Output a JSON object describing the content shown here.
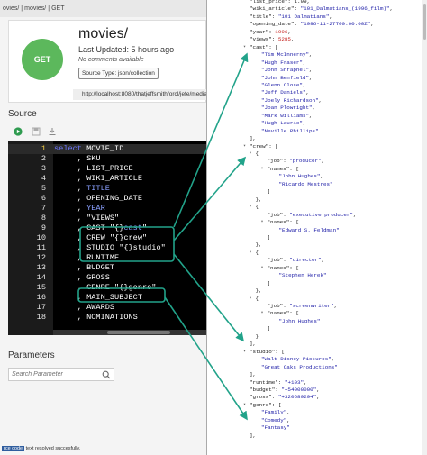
{
  "breadcrumb": {
    "items": [
      "ovies/",
      "|",
      "movies/",
      "|",
      "GET"
    ]
  },
  "card": {
    "method": "GET",
    "title": "movies/",
    "updated": "Last Updated: 5 hours ago",
    "comments": "No comments available",
    "source_type": "Source Type: json/collection",
    "url": "http://localhost:8080/thatjeffsmith/orcl/jefe/media/"
  },
  "source": {
    "label": "Source",
    "lines": [
      {
        "n": "1",
        "parts": [
          {
            "t": "select",
            "c": "kw"
          },
          {
            "t": " MOVIE_ID",
            "c": ""
          }
        ]
      },
      {
        "n": "2",
        "parts": [
          {
            "t": "     , SKU",
            "c": ""
          }
        ]
      },
      {
        "n": "3",
        "parts": [
          {
            "t": "     , LIST_PRICE",
            "c": ""
          }
        ]
      },
      {
        "n": "4",
        "parts": [
          {
            "t": "     , WIKI_ARTICLE",
            "c": ""
          }
        ]
      },
      {
        "n": "5",
        "parts": [
          {
            "t": "     , ",
            "c": ""
          },
          {
            "t": "TITLE",
            "c": "col-hl"
          }
        ]
      },
      {
        "n": "6",
        "parts": [
          {
            "t": "     , OPENING_DATE",
            "c": ""
          }
        ]
      },
      {
        "n": "7",
        "parts": [
          {
            "t": "     , ",
            "c": ""
          },
          {
            "t": "YEAR",
            "c": "col-hl"
          }
        ]
      },
      {
        "n": "8",
        "parts": [
          {
            "t": "     , \"VIEWS\"",
            "c": ""
          }
        ]
      },
      {
        "n": "9",
        "parts": [
          {
            "t": "     , CAST \"{}",
            "c": ""
          },
          {
            "t": "cast",
            "c": "col-hl"
          },
          {
            "t": "\"",
            "c": ""
          }
        ]
      },
      {
        "n": "10",
        "parts": [
          {
            "t": "     , CREW \"{}crew\"",
            "c": ""
          }
        ]
      },
      {
        "n": "11",
        "parts": [
          {
            "t": "     , STUDIO \"{}studio\"",
            "c": ""
          }
        ]
      },
      {
        "n": "12",
        "parts": [
          {
            "t": "     , RUNTIME",
            "c": ""
          }
        ]
      },
      {
        "n": "13",
        "parts": [
          {
            "t": "     , BUDGET",
            "c": ""
          }
        ]
      },
      {
        "n": "14",
        "parts": [
          {
            "t": "     , GROSS",
            "c": ""
          }
        ]
      },
      {
        "n": "15",
        "parts": [
          {
            "t": "     , GENRE \"{}genre\"",
            "c": ""
          }
        ]
      },
      {
        "n": "16",
        "parts": [
          {
            "t": "     , MAIN_SUBJECT",
            "c": ""
          }
        ]
      },
      {
        "n": "17",
        "parts": [
          {
            "t": "     , AWARDS",
            "c": ""
          }
        ]
      },
      {
        "n": "18",
        "parts": [
          {
            "t": "     , NOMINATIONS",
            "c": ""
          }
        ]
      }
    ],
    "active_line": "1"
  },
  "parameters": {
    "label": "Parameters",
    "search_placeholder": "Search Parameter"
  },
  "status": {
    "selected": "rce code",
    "message": " text resolved succesfully."
  },
  "json_view": {
    "lines": [
      {
        "i": 2,
        "raw": "\"list_price\": 1.99,"
      },
      {
        "i": 2,
        "k": "\"wiki_article\"",
        "v": "\"101_Dalmatians_(1996_film)\"",
        "vt": "s",
        "end": ","
      },
      {
        "i": 2,
        "k": "\"title\"",
        "v": "\"101 Dalmatians\"",
        "vt": "s",
        "end": ","
      },
      {
        "i": 2,
        "k": "\"opening_date\"",
        "v": "\"1996-11-27T00:00:00Z\"",
        "vt": "s",
        "end": ","
      },
      {
        "i": 2,
        "k": "\"year\"",
        "v": "1996",
        "vt": "n",
        "end": ","
      },
      {
        "i": 2,
        "k": "\"views\"",
        "v": "5285",
        "vt": "n",
        "end": ","
      },
      {
        "i": 2,
        "k": "\"cast\"",
        "v": "[",
        "vt": "p",
        "end": "",
        "tog": true
      },
      {
        "i": 4,
        "v": "\"Tim McInnerny\"",
        "vt": "s",
        "end": ","
      },
      {
        "i": 4,
        "v": "\"Hugh Fraser\"",
        "vt": "s",
        "end": ","
      },
      {
        "i": 4,
        "v": "\"John Shrapnel\"",
        "vt": "s",
        "end": ","
      },
      {
        "i": 4,
        "v": "\"John Benfield\"",
        "vt": "s",
        "end": ","
      },
      {
        "i": 4,
        "v": "\"Glenn Close\"",
        "vt": "s",
        "end": ","
      },
      {
        "i": 4,
        "v": "\"Jeff Daniels\"",
        "vt": "s",
        "end": ","
      },
      {
        "i": 4,
        "v": "\"Joely Richardson\"",
        "vt": "s",
        "end": ","
      },
      {
        "i": 4,
        "v": "\"Joan Plowright\"",
        "vt": "s",
        "end": ","
      },
      {
        "i": 4,
        "v": "\"Mark Williams\"",
        "vt": "s",
        "end": ","
      },
      {
        "i": 4,
        "v": "\"Hugh Laurie\"",
        "vt": "s",
        "end": ","
      },
      {
        "i": 4,
        "v": "\"Neville Phillips\"",
        "vt": "s",
        "end": ""
      },
      {
        "i": 2,
        "v": "],",
        "vt": "p",
        "end": ""
      },
      {
        "i": 2,
        "k": "\"crew\"",
        "v": "[",
        "vt": "p",
        "end": "",
        "tog": true
      },
      {
        "i": 3,
        "v": "{",
        "vt": "p",
        "end": "",
        "tog": true
      },
      {
        "i": 5,
        "k": "\"job\"",
        "v": "\"producer\"",
        "vt": "s",
        "end": ","
      },
      {
        "i": 5,
        "k": "\"names\"",
        "v": "[",
        "vt": "p",
        "end": "",
        "tog": true
      },
      {
        "i": 7,
        "v": "\"John Hughes\"",
        "vt": "s",
        "end": ","
      },
      {
        "i": 7,
        "v": "\"Ricardo Mestres\"",
        "vt": "s",
        "end": ""
      },
      {
        "i": 5,
        "v": "]",
        "vt": "p",
        "end": ""
      },
      {
        "i": 3,
        "v": "},",
        "vt": "p",
        "end": ""
      },
      {
        "i": 3,
        "v": "{",
        "vt": "p",
        "end": "",
        "tog": true
      },
      {
        "i": 5,
        "k": "\"job\"",
        "v": "\"executive producer\"",
        "vt": "s",
        "end": ","
      },
      {
        "i": 5,
        "k": "\"names\"",
        "v": "[",
        "vt": "p",
        "end": "",
        "tog": true
      },
      {
        "i": 7,
        "v": "\"Edward S. Feldman\"",
        "vt": "s",
        "end": ""
      },
      {
        "i": 5,
        "v": "]",
        "vt": "p",
        "end": ""
      },
      {
        "i": 3,
        "v": "},",
        "vt": "p",
        "end": ""
      },
      {
        "i": 3,
        "v": "{",
        "vt": "p",
        "end": "",
        "tog": true
      },
      {
        "i": 5,
        "k": "\"job\"",
        "v": "\"director\"",
        "vt": "s",
        "end": ","
      },
      {
        "i": 5,
        "k": "\"names\"",
        "v": "[",
        "vt": "p",
        "end": "",
        "tog": true
      },
      {
        "i": 7,
        "v": "\"Stephen Herek\"",
        "vt": "s",
        "end": ""
      },
      {
        "i": 5,
        "v": "]",
        "vt": "p",
        "end": ""
      },
      {
        "i": 3,
        "v": "},",
        "vt": "p",
        "end": ""
      },
      {
        "i": 3,
        "v": "{",
        "vt": "p",
        "end": "",
        "tog": true
      },
      {
        "i": 5,
        "k": "\"job\"",
        "v": "\"screenwriter\"",
        "vt": "s",
        "end": ","
      },
      {
        "i": 5,
        "k": "\"names\"",
        "v": "[",
        "vt": "p",
        "end": "",
        "tog": true
      },
      {
        "i": 7,
        "v": "\"John Hughes\"",
        "vt": "s",
        "end": ""
      },
      {
        "i": 5,
        "v": "]",
        "vt": "p",
        "end": ""
      },
      {
        "i": 3,
        "v": "}",
        "vt": "p",
        "end": ""
      },
      {
        "i": 2,
        "v": "],",
        "vt": "p",
        "end": ""
      },
      {
        "i": 2,
        "k": "\"studio\"",
        "v": "[",
        "vt": "p",
        "end": "",
        "tog": true
      },
      {
        "i": 4,
        "v": "\"Walt Disney Pictures\"",
        "vt": "s",
        "end": ","
      },
      {
        "i": 4,
        "v": "\"Great Oaks Productions\"",
        "vt": "s",
        "end": ""
      },
      {
        "i": 2,
        "v": "],",
        "vt": "p",
        "end": ""
      },
      {
        "i": 2,
        "k": "\"runtime\"",
        "v": "\"+103\"",
        "vt": "s",
        "end": ","
      },
      {
        "i": 2,
        "k": "\"budget\"",
        "v": "\"+54000000\"",
        "vt": "s",
        "end": ","
      },
      {
        "i": 2,
        "k": "\"gross\"",
        "v": "\"+320689294\"",
        "vt": "s",
        "end": ","
      },
      {
        "i": 2,
        "k": "\"genre\"",
        "v": "[",
        "vt": "p",
        "end": "",
        "tog": true
      },
      {
        "i": 4,
        "v": "\"Family\"",
        "vt": "s",
        "end": ","
      },
      {
        "i": 4,
        "v": "\"Comedy\"",
        "vt": "s",
        "end": ","
      },
      {
        "i": 4,
        "v": "\"Fantasy\"",
        "vt": "s",
        "end": ""
      },
      {
        "i": 2,
        "v": "],",
        "vt": "p",
        "end": ""
      }
    ]
  },
  "colors": {
    "accent_arrow": "#22a38a",
    "get_green": "#5cb85c",
    "editor_bg": "#000000",
    "keyword": "#6e78ff"
  }
}
